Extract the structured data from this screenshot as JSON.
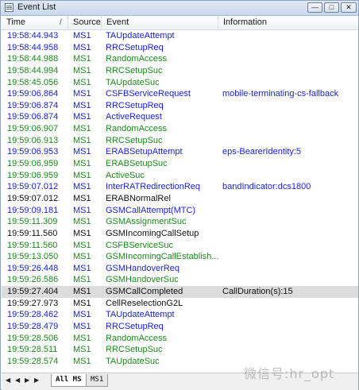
{
  "window": {
    "title": "Event List",
    "min_glyph": "—",
    "max_glyph": "□",
    "close_glyph": "✕"
  },
  "header": {
    "time": "Time",
    "sort_marker": "/",
    "source": "Source",
    "event": "Event",
    "information": "Information"
  },
  "colors": {
    "blue": "#1a24d6",
    "green": "#1a8a1a",
    "black": "#111111"
  },
  "rows": [
    {
      "time": "19:58:44.943",
      "source": "MS1",
      "event": "TAUpdateAttempt",
      "info": "",
      "color": "blue"
    },
    {
      "time": "19:58:44.958",
      "source": "MS1",
      "event": "RRCSetupReq",
      "info": "",
      "color": "blue"
    },
    {
      "time": "19:58:44.988",
      "source": "MS1",
      "event": "RandomAccess",
      "info": "",
      "color": "green"
    },
    {
      "time": "19:58:44.994",
      "source": "MS1",
      "event": "RRCSetupSuc",
      "info": "",
      "color": "green"
    },
    {
      "time": "19:58:45.056",
      "source": "MS1",
      "event": "TAUpdateSuc",
      "info": "",
      "color": "green"
    },
    {
      "time": "19:59:06.864",
      "source": "MS1",
      "event": "CSFBServiceRequest",
      "info": "mobile-terminating-cs-fallback",
      "color": "blue"
    },
    {
      "time": "19:59:06.874",
      "source": "MS1",
      "event": "RRCSetupReq",
      "info": "",
      "color": "blue"
    },
    {
      "time": "19:59:06.874",
      "source": "MS1",
      "event": "ActiveRequest",
      "info": "",
      "color": "blue"
    },
    {
      "time": "19:59:06.907",
      "source": "MS1",
      "event": "RandomAccess",
      "info": "",
      "color": "green"
    },
    {
      "time": "19:59:06.913",
      "source": "MS1",
      "event": "RRCSetupSuc",
      "info": "",
      "color": "green"
    },
    {
      "time": "19:59:06.953",
      "source": "MS1",
      "event": "ERABSetupAttempt",
      "info": "eps-BearerIdentity:5",
      "color": "blue"
    },
    {
      "time": "19:59:06.959",
      "source": "MS1",
      "event": "ERABSetupSuc",
      "info": "",
      "color": "green"
    },
    {
      "time": "19:59:06.959",
      "source": "MS1",
      "event": "ActiveSuc",
      "info": "",
      "color": "green"
    },
    {
      "time": "19:59:07.012",
      "source": "MS1",
      "event": "InterRATRedirectionReq",
      "info": "bandIndicator:dcs1800",
      "color": "blue"
    },
    {
      "time": "19:59:07.012",
      "source": "MS1",
      "event": "ERABNormalRel",
      "info": "",
      "color": "black"
    },
    {
      "time": "19:59:09.181",
      "source": "MS1",
      "event": "GSMCallAttempt(MTC)",
      "info": "",
      "color": "blue"
    },
    {
      "time": "19:59:11.309",
      "source": "MS1",
      "event": "GSMAssignmentSuc",
      "info": "",
      "color": "green"
    },
    {
      "time": "19:59:11.560",
      "source": "MS1",
      "event": "GSMIncomingCallSetup",
      "info": "",
      "color": "black"
    },
    {
      "time": "19:59:11.560",
      "source": "MS1",
      "event": "CSFBServiceSuc",
      "info": "",
      "color": "green"
    },
    {
      "time": "19:59:13.050",
      "source": "MS1",
      "event": "GSMIncomingCallEstablish...",
      "info": "",
      "color": "green"
    },
    {
      "time": "19:59:26.448",
      "source": "MS1",
      "event": "GSMHandoverReq",
      "info": "",
      "color": "blue"
    },
    {
      "time": "19:59:26.586",
      "source": "MS1",
      "event": "GSMHandoverSuc",
      "info": "",
      "color": "green"
    },
    {
      "time": "19:59:27.404",
      "source": "MS1",
      "event": "GSMCallCompleted",
      "info": "CallDuration(s):15",
      "color": "black",
      "selected": true
    },
    {
      "time": "19:59:27.973",
      "source": "MS1",
      "event": "CellReselectionG2L",
      "info": "",
      "color": "black"
    },
    {
      "time": "19:59:28.462",
      "source": "MS1",
      "event": "TAUpdateAttempt",
      "info": "",
      "color": "blue"
    },
    {
      "time": "19:59:28.479",
      "source": "MS1",
      "event": "RRCSetupReq",
      "info": "",
      "color": "blue"
    },
    {
      "time": "19:59:28.506",
      "source": "MS1",
      "event": "RandomAccess",
      "info": "",
      "color": "green"
    },
    {
      "time": "19:59:28.511",
      "source": "MS1",
      "event": "RRCSetupSuc",
      "info": "",
      "color": "green"
    },
    {
      "time": "19:59:28.574",
      "source": "MS1",
      "event": "TAUpdateSuc",
      "info": "",
      "color": "green"
    }
  ],
  "tabs": {
    "nav_first": "◀",
    "nav_prev": "◀",
    "nav_next": "▶",
    "nav_last": "▶",
    "all": "All MS",
    "ms1": "MS1"
  },
  "watermark": "微信号:hr_opt"
}
